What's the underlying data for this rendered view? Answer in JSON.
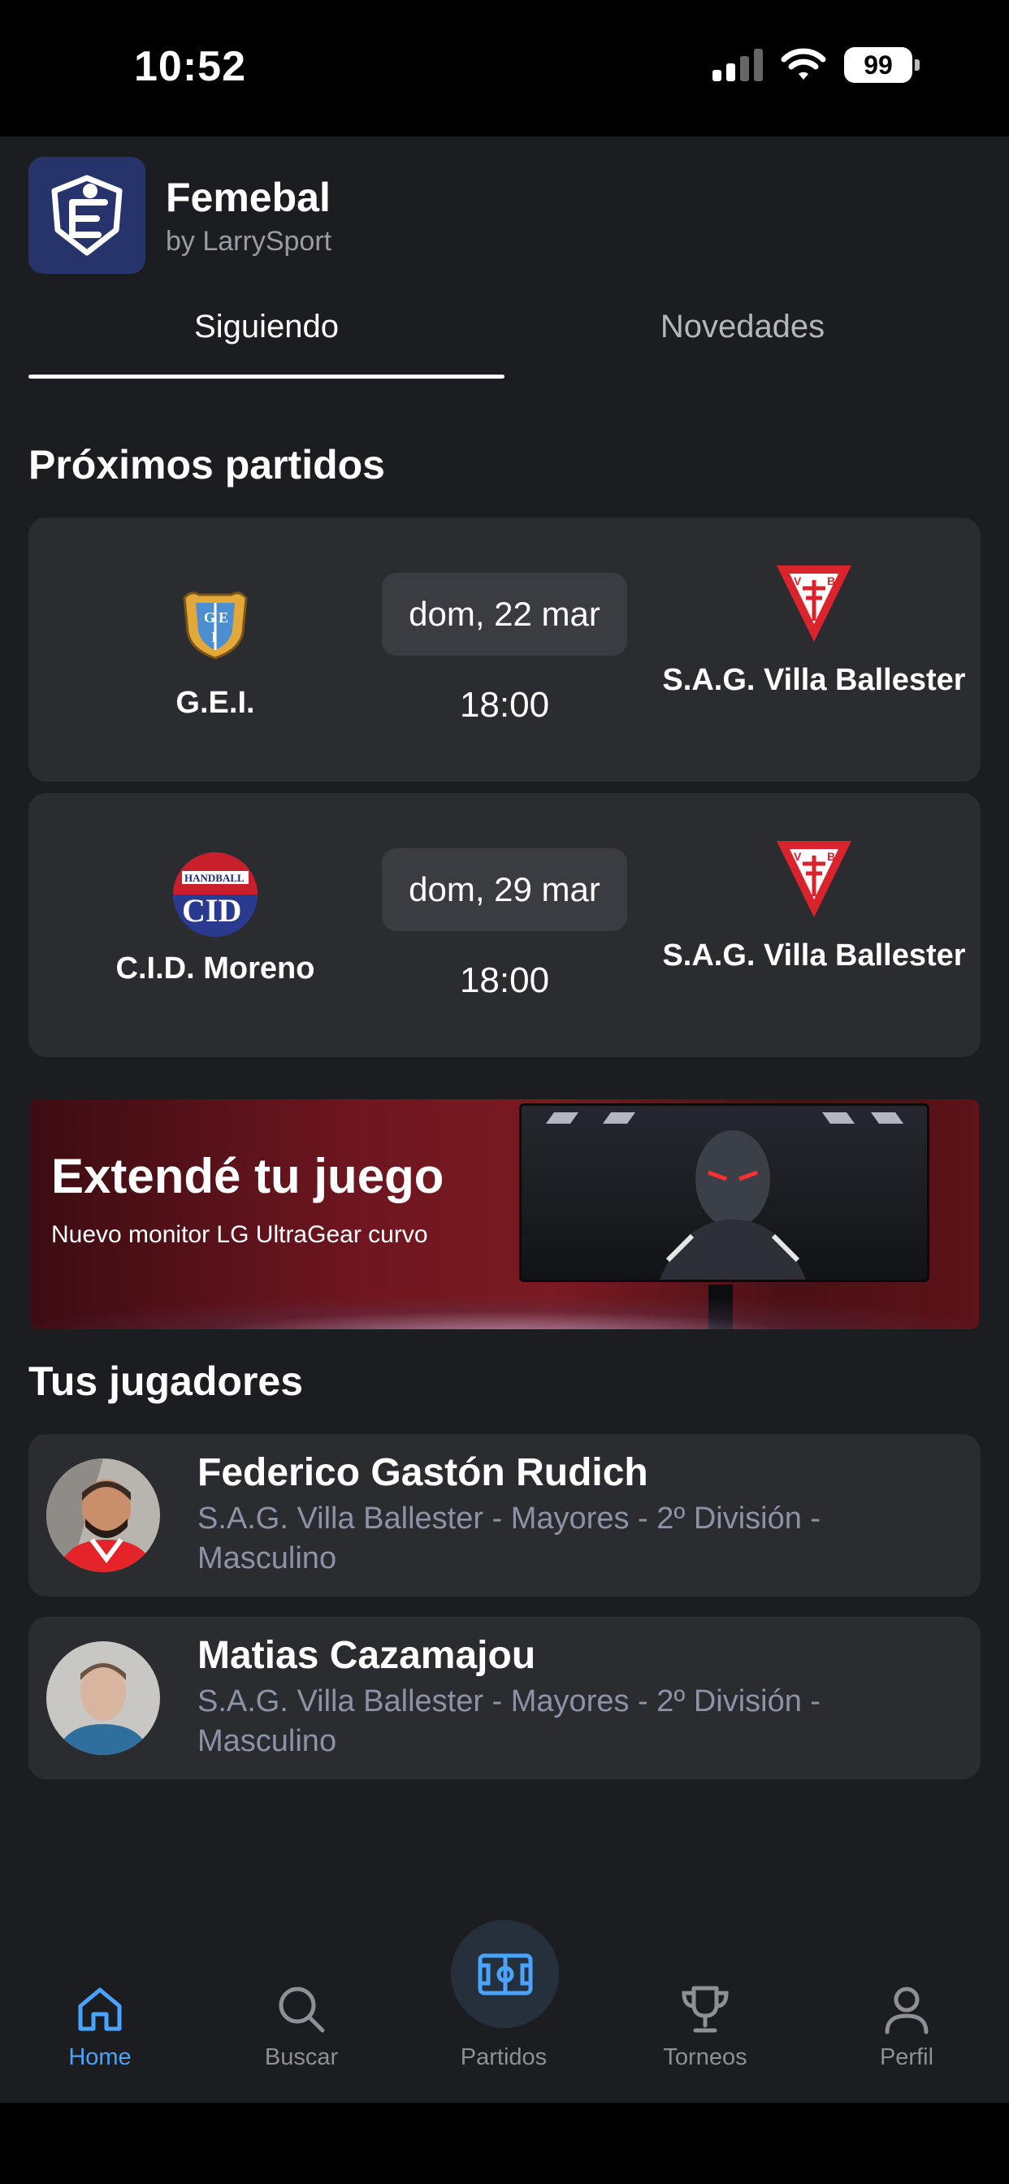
{
  "status_bar": {
    "time": "10:52",
    "battery": "99"
  },
  "app": {
    "name": "Femebal",
    "by_line": "by LarrySport"
  },
  "tabs": [
    {
      "label": "Siguiendo",
      "active": true
    },
    {
      "label": "Novedades",
      "active": false
    }
  ],
  "upcoming": {
    "title": "Próximos partidos",
    "matches": [
      {
        "home": "G.E.I.",
        "date": "dom, 22 mar",
        "time": "18:00",
        "away": "S.A.G. Villa Ballester"
      },
      {
        "home": "C.I.D. Moreno",
        "date": "dom, 29 mar",
        "time": "18:00",
        "away": "S.A.G. Villa Ballester"
      }
    ]
  },
  "banner": {
    "headline": "Extendé tu juego",
    "subline": "Nuevo monitor LG UltraGear curvo"
  },
  "players": {
    "title": "Tus jugadores",
    "items": [
      {
        "name": "Federico Gastón Rudich",
        "team": "S.A.G. Villa Ballester - Mayores - 2º División - Masculino"
      },
      {
        "name": "Matias Cazamajou",
        "team": "S.A.G. Villa Ballester - Mayores - 2º División - Masculino"
      }
    ]
  },
  "tabbar": {
    "items": [
      {
        "label": "Home",
        "icon": "home-icon",
        "active": true
      },
      {
        "label": "Buscar",
        "icon": "search-icon",
        "active": false
      },
      {
        "label": "Partidos",
        "icon": "field-icon",
        "active": false
      },
      {
        "label": "Torneos",
        "icon": "trophy-icon",
        "active": false
      },
      {
        "label": "Perfil",
        "icon": "person-icon",
        "active": false
      }
    ]
  },
  "colors": {
    "accent": "#4aa3ff",
    "background": "#1c1d21",
    "card": "#2b2c30",
    "logo_bg": "#26346b"
  }
}
